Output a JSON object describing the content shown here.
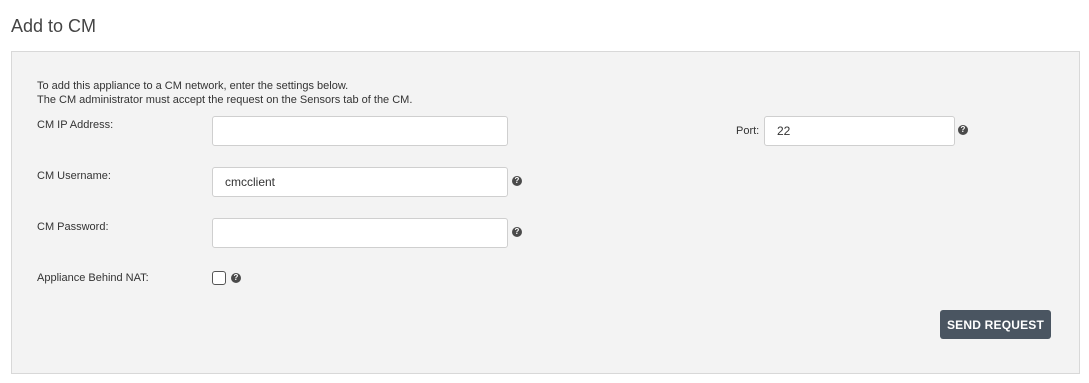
{
  "page": {
    "title": "Add to CM"
  },
  "intro": {
    "line1": "To add this appliance to a CM network, enter the settings below.",
    "line2": "The CM administrator must accept the request on the Sensors tab of the CM."
  },
  "form": {
    "ip_label": "CM IP Address:",
    "ip_value": "",
    "port_label": "Port:",
    "port_value": "22",
    "username_label": "CM Username:",
    "username_value": "cmcclient",
    "password_label": "CM Password:",
    "password_value": "",
    "nat_label": "Appliance Behind NAT:",
    "nat_checked": false
  },
  "help_glyph": "?",
  "icons": {
    "help": "question-circle-icon"
  },
  "actions": {
    "send_label": "SEND REQUEST"
  },
  "colors": {
    "button_bg": "#4a5561",
    "panel_bg": "#f3f3f3",
    "help_icon": "#4a4a4a"
  }
}
